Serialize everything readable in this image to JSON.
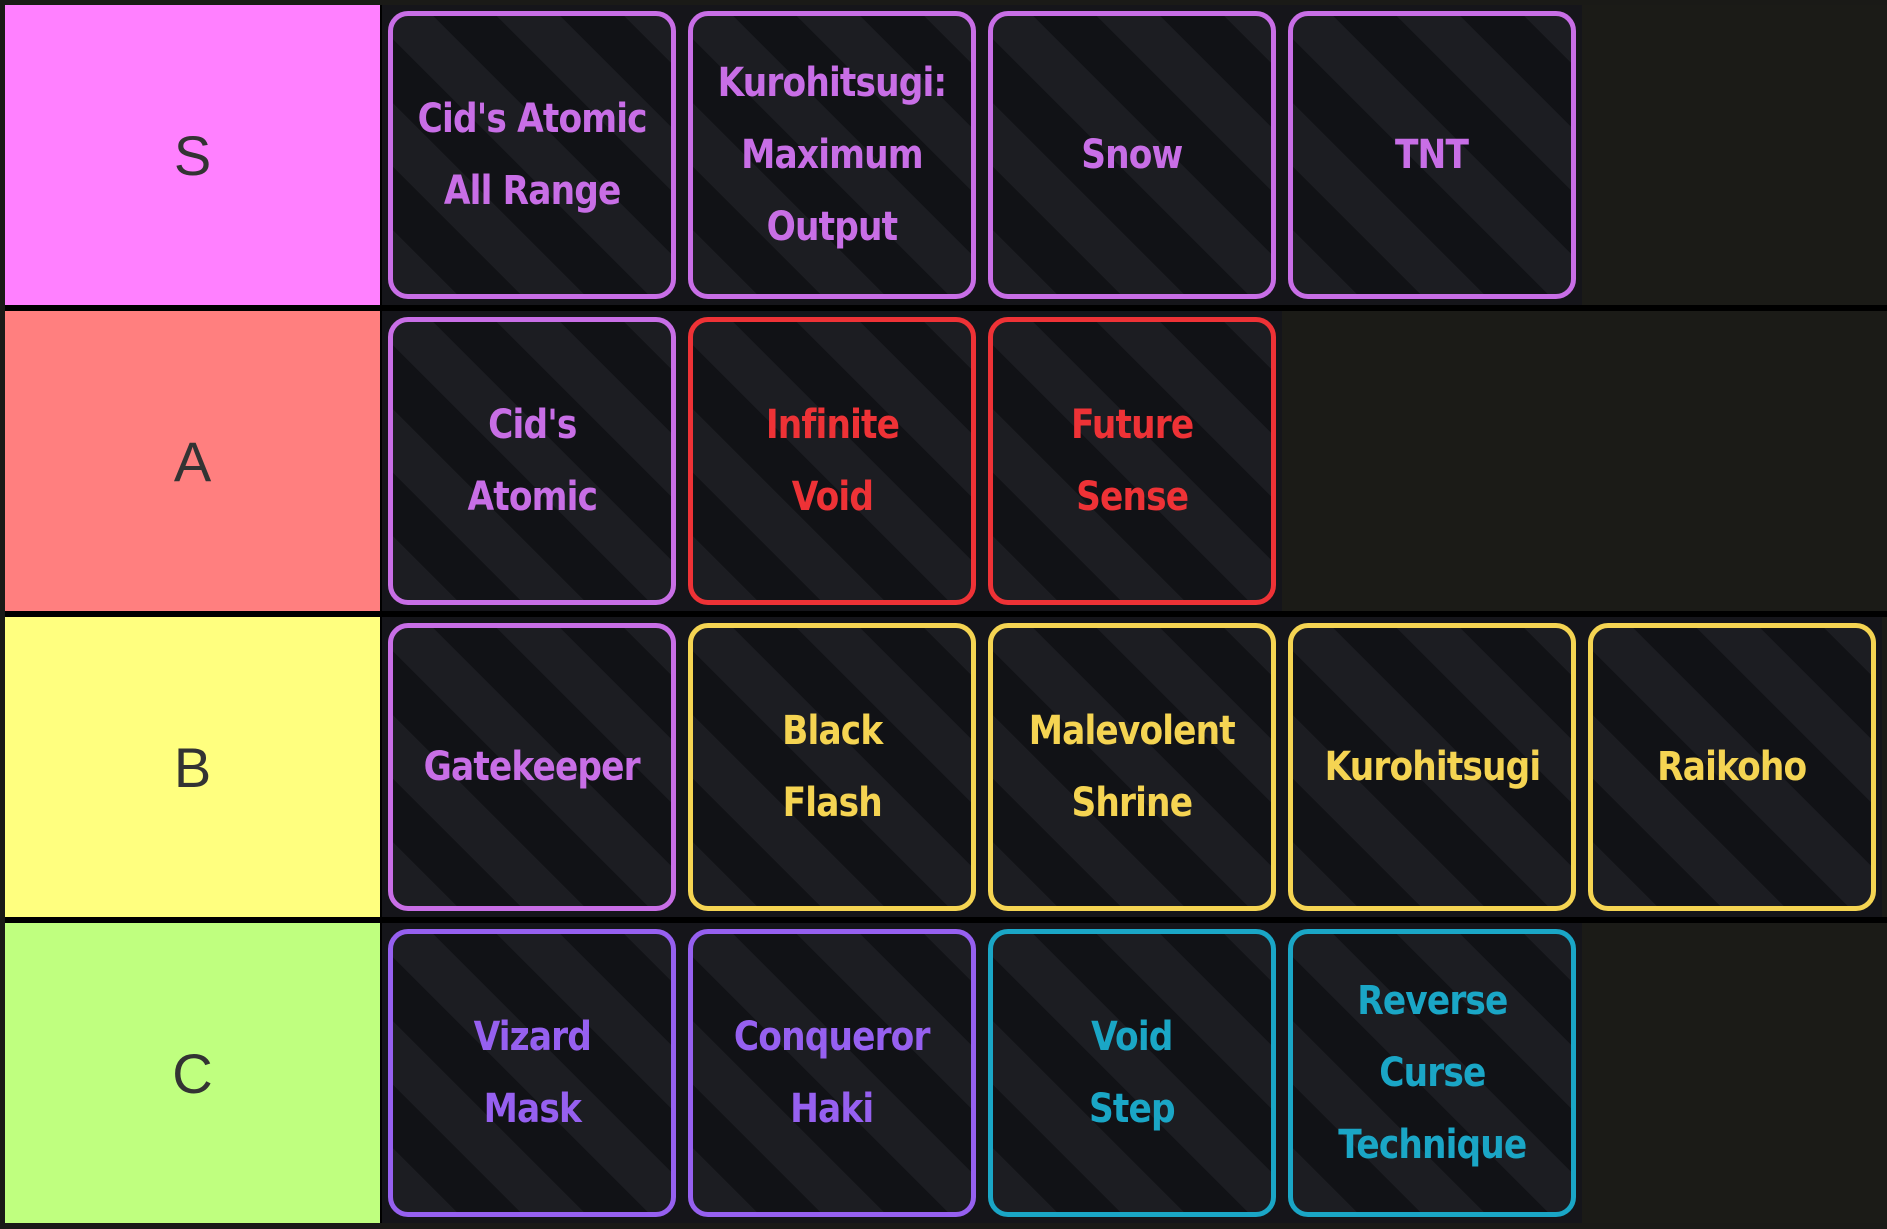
{
  "rarity_colors": {
    "mythic": "#c86ee6",
    "legendary": "#f5d452",
    "secret": "#ee3236",
    "epic": "#9660f0",
    "rare": "#1aa6c6"
  },
  "tiers": [
    {
      "label": "S",
      "color": "#ff80ff",
      "items": [
        {
          "name": "Cid's Atomic\nAll Range",
          "rarity": "mythic"
        },
        {
          "name": "Kurohitsugi:\nMaximum\nOutput",
          "rarity": "mythic"
        },
        {
          "name": "Snow",
          "rarity": "mythic"
        },
        {
          "name": "TNT",
          "rarity": "mythic"
        }
      ]
    },
    {
      "label": "A",
      "color": "#ff7f7f",
      "items": [
        {
          "name": "Cid's\nAtomic",
          "rarity": "mythic"
        },
        {
          "name": "Infinite\nVoid",
          "rarity": "secret"
        },
        {
          "name": "Future\nSense",
          "rarity": "secret"
        }
      ]
    },
    {
      "label": "B",
      "color": "#ffff7f",
      "items": [
        {
          "name": "Gatekeeper",
          "rarity": "mythic"
        },
        {
          "name": "Black\nFlash",
          "rarity": "legendary"
        },
        {
          "name": "Malevolent\nShrine",
          "rarity": "legendary"
        },
        {
          "name": "Kurohitsugi",
          "rarity": "legendary"
        },
        {
          "name": "Raikoho",
          "rarity": "legendary"
        }
      ]
    },
    {
      "label": "C",
      "color": "#bfff7f",
      "items": [
        {
          "name": "Vizard\nMask",
          "rarity": "epic"
        },
        {
          "name": "Conqueror\nHaki",
          "rarity": "epic"
        },
        {
          "name": "Void\nStep",
          "rarity": "rare"
        },
        {
          "name": "Reverse\nCurse\nTechnique",
          "rarity": "rare"
        }
      ]
    }
  ]
}
